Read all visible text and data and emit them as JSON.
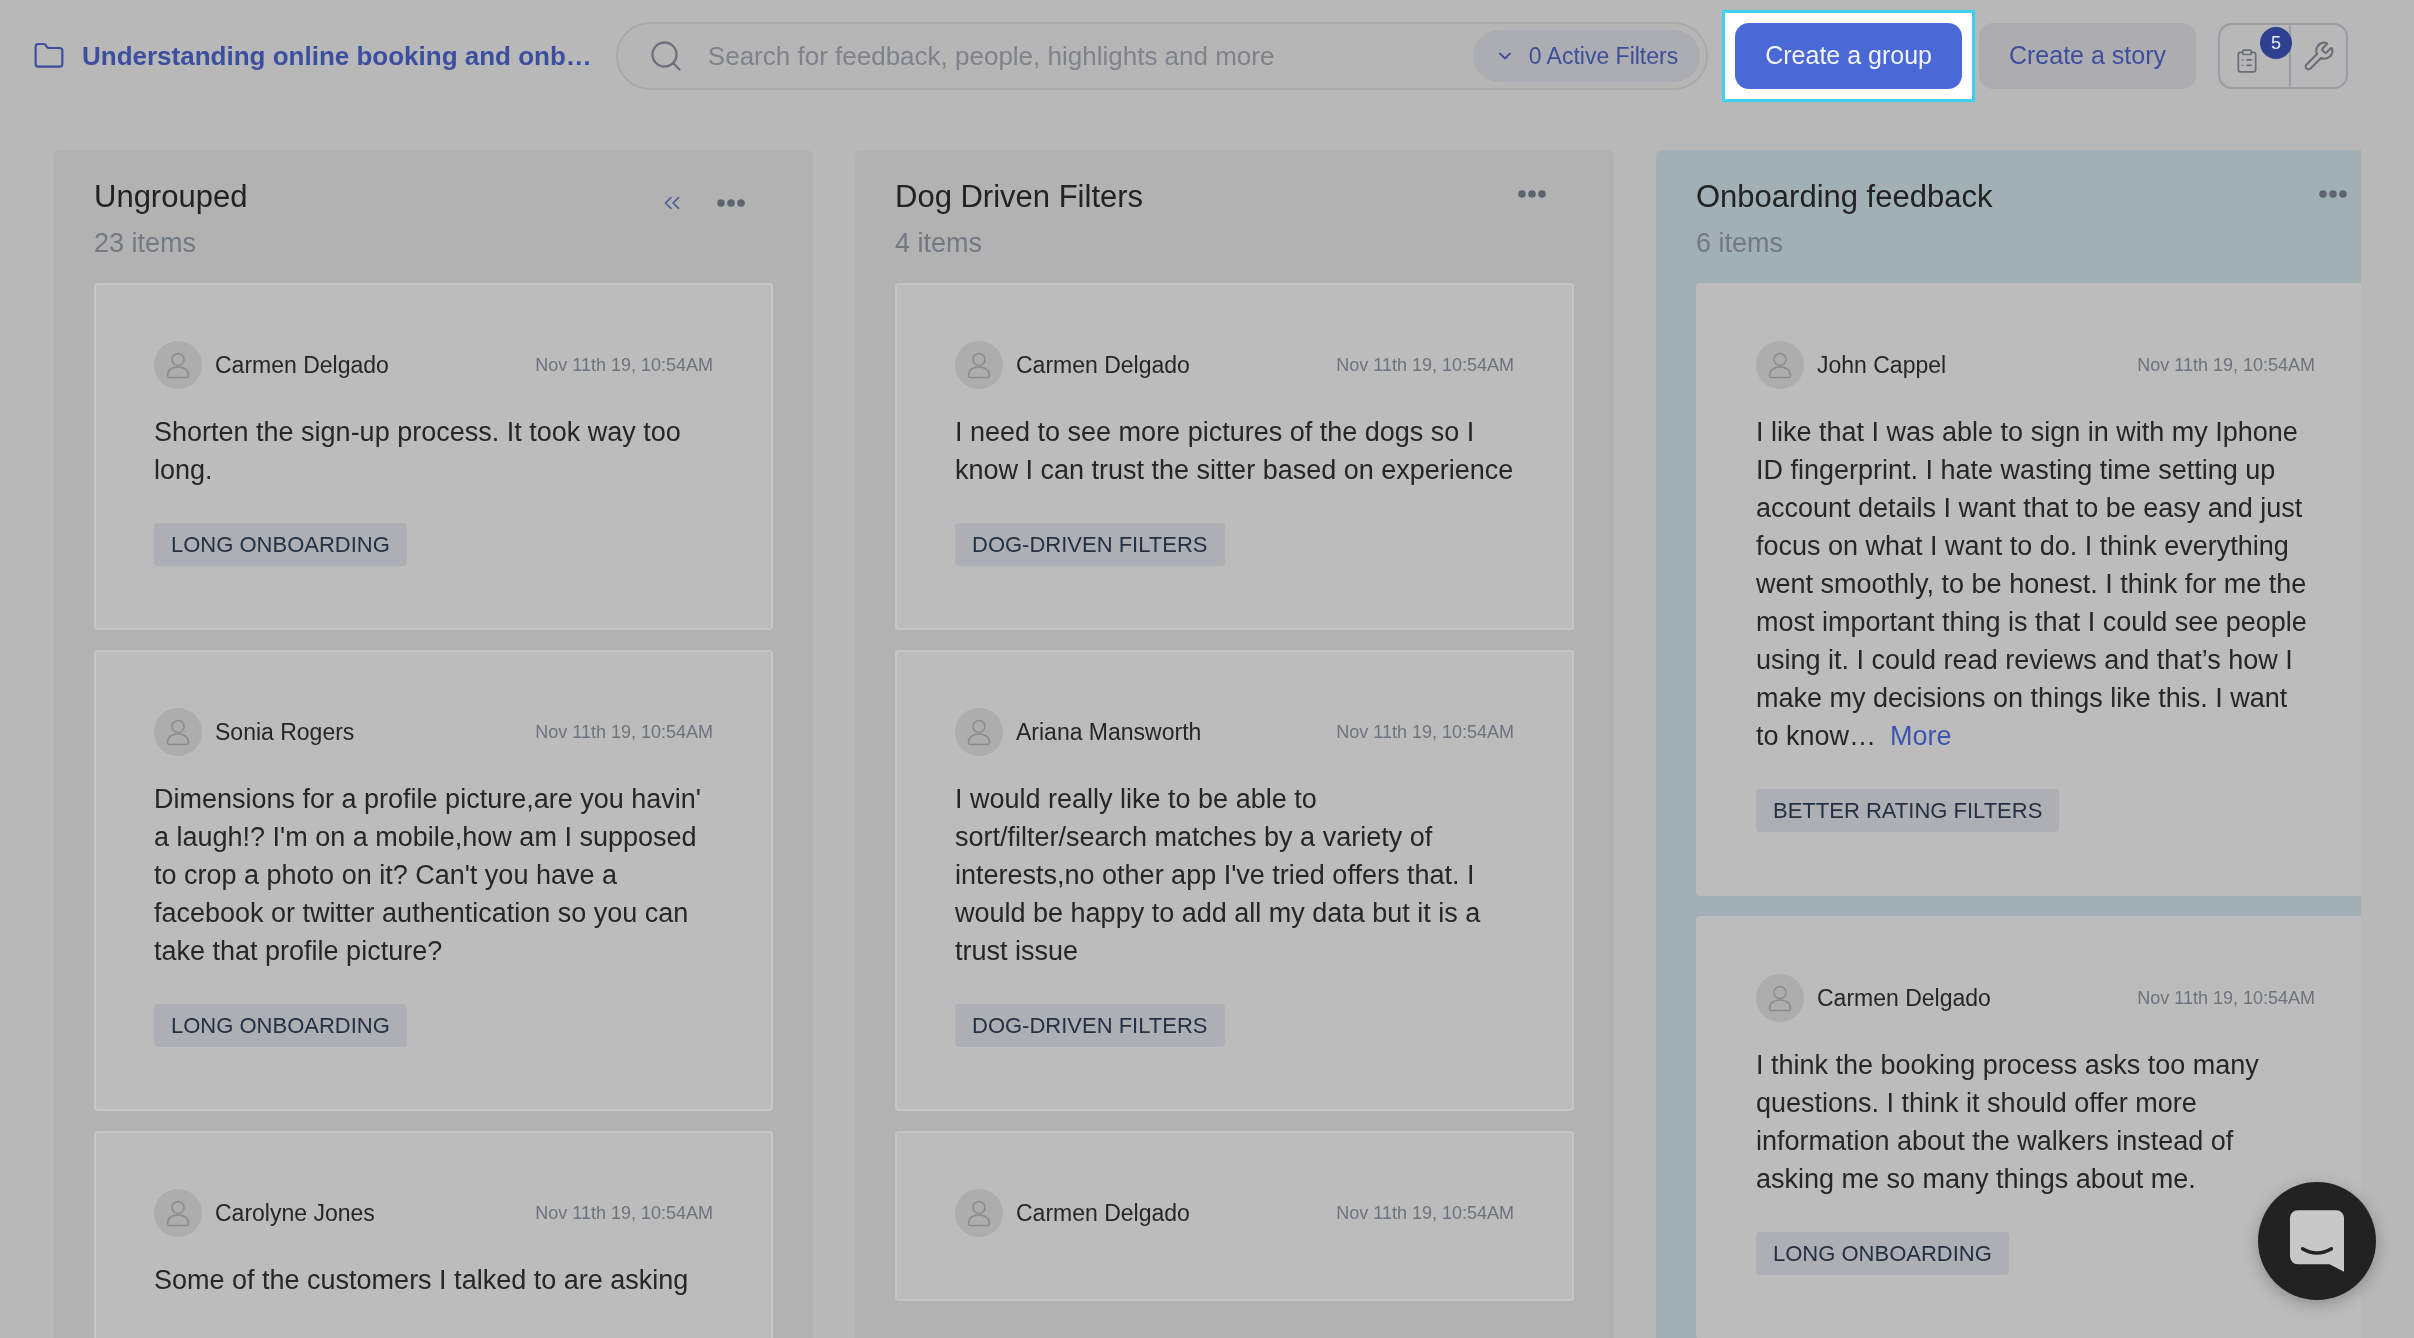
{
  "project": {
    "title": "Understanding online booking and onb…"
  },
  "search": {
    "placeholder": "Search for feedback, people, highlights and more",
    "filters": "0 Active Filters"
  },
  "actions": [
    {
      "label": "Create a group",
      "kind": "primary",
      "highlighted": true
    },
    {
      "label": "Create a story",
      "kind": "secondary",
      "highlighted": false
    }
  ],
  "notifications": {
    "count": "5"
  },
  "groups": [
    {
      "title": "Ungrouped",
      "count": "23 items",
      "selected": false,
      "collapsible": true,
      "cards": [
        {
          "author": "Carmen Delgado",
          "date": "Nov 11th 19, 10:54AM",
          "text": "Shorten the sign-up process. It took way too long.",
          "tag": "LONG ONBOARDING"
        },
        {
          "author": "Sonia Rogers",
          "date": "Nov 11th 19, 10:54AM",
          "text": "Dimensions for a profile picture,are you havin' a laugh!? I'm on a mobile,how am I supposed to crop a photo on it? Can't you have a facebook or twitter authentication so you can take that profile picture?",
          "tag": "LONG ONBOARDING"
        },
        {
          "author": "Carolyne Jones",
          "date": "Nov 11th 19, 10:54AM",
          "text": "Some of the customers I talked to are asking"
        }
      ]
    },
    {
      "title": "Dog Driven Filters",
      "count": "4 items",
      "selected": false,
      "collapsible": false,
      "cards": [
        {
          "author": "Carmen Delgado",
          "date": "Nov 11th 19, 10:54AM",
          "text": "I need to see more pictures of the dogs so I know I can trust the sitter based on experience",
          "tag": "DOG-DRIVEN FILTERS"
        },
        {
          "author": "Ariana Mansworth",
          "date": "Nov 11th 19, 10:54AM",
          "text": "I would really like to be able to sort/filter/search matches by a variety of interests,no other app I've tried offers that. I would be happy to add all my data but it is a trust issue",
          "tag": "DOG-DRIVEN FILTERS"
        },
        {
          "author": "Carmen Delgado",
          "date": "Nov 11th 19, 10:54AM"
        }
      ]
    },
    {
      "title": "Onboarding feedback",
      "count": "6 items",
      "selected": true,
      "collapsible": false,
      "cards": [
        {
          "author": "John Cappel",
          "date": "Nov 11th 19, 10:54AM",
          "text": "I like that I was able to sign in with my Iphone ID fingerprint. I hate wasting time setting up account details I want that to be easy and just focus on what I want to do. I think everything went smoothly, to be honest. I think for me the most important thing is that I could see people using it. I could read reviews and that’s how I make my decisions on things like this. I want to know…",
          "more": "More",
          "tag": "BETTER RATING FILTERS"
        },
        {
          "author": "Carmen Delgado",
          "date": "Nov 11th 19, 10:54AM",
          "text": "I think the booking process asks too many questions. I think it should offer more information about the walkers instead of asking me so many things about me.",
          "tag": "LONG ONBOARDING"
        }
      ]
    }
  ]
}
